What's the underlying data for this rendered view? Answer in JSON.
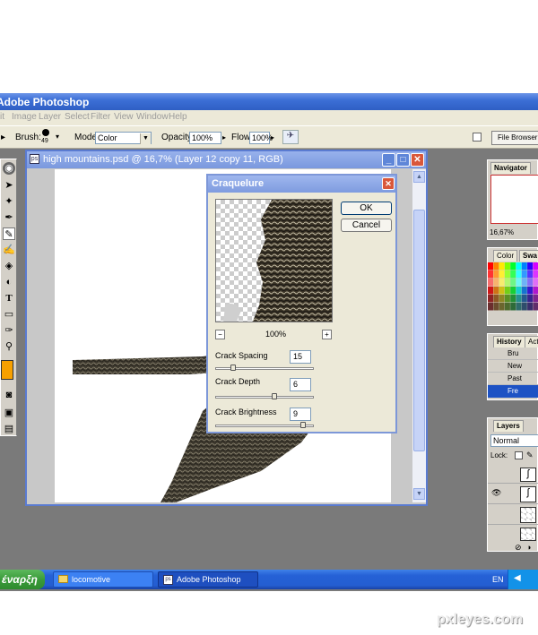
{
  "app": {
    "title": "Adobe Photoshop"
  },
  "menu": [
    "it",
    "Image",
    "Layer",
    "Select",
    "Filter",
    "View",
    "Window",
    "Help"
  ],
  "options": {
    "brush_label": "Brush:",
    "brush_size": "49",
    "mode_label": "Mode:",
    "mode_value": "Color",
    "opacity_label": "Opacity:",
    "opacity_value": "100%",
    "flow_label": "Flow:",
    "flow_value": "100%",
    "file_browser": "File Browser"
  },
  "document": {
    "title": "high mountains.psd @ 16,7% (Layer 12 copy 11, RGB)"
  },
  "dialog": {
    "title": "Craquelure",
    "ok": "OK",
    "cancel": "Cancel",
    "zoom": "100%",
    "zoom_out": "−",
    "zoom_in": "+",
    "params": [
      {
        "label": "Crack Spacing",
        "value": "15",
        "fraction": 0.15
      },
      {
        "label": "Crack Depth",
        "value": "6",
        "fraction": 0.6
      },
      {
        "label": "Crack Brightness",
        "value": "9",
        "fraction": 0.9
      }
    ]
  },
  "panels": {
    "navigator": {
      "tab": "Navigator",
      "zoom": "16,67%"
    },
    "color": {
      "tab1": "Color",
      "tab2": "Swa"
    },
    "history": {
      "tab1": "History",
      "tab2": "Act",
      "items": [
        "Bru",
        "New",
        "Past",
        "Fre"
      ]
    },
    "layers": {
      "tab": "Layers",
      "blend": "Normal",
      "lock": "Lock:"
    }
  },
  "taskbar": {
    "start": "έναρξη",
    "items": [
      "locomotive",
      "Adobe Photoshop"
    ],
    "lang": "EN"
  },
  "watermark": "pxleyes.com",
  "colors": {
    "xp_blue": "#245ed1",
    "start_green": "#3a9b3a",
    "dialog_bg": "#ece9d8"
  }
}
